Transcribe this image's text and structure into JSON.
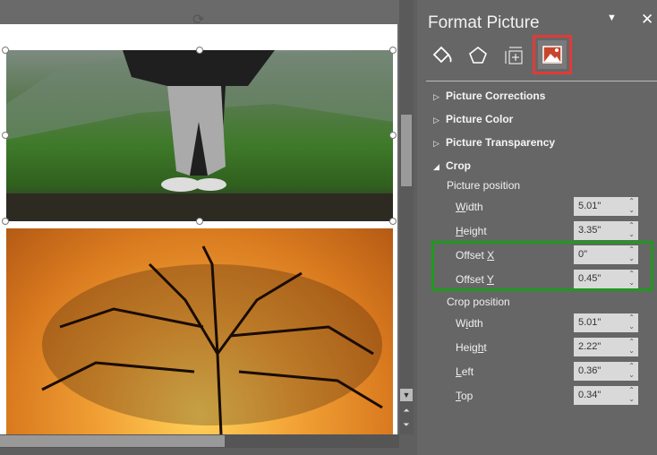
{
  "panel": {
    "title": "Format Picture",
    "tabs": [
      "fill-line",
      "effects",
      "size-properties",
      "picture"
    ],
    "sections": {
      "corrections": "Picture Corrections",
      "color": "Picture Color",
      "transparency": "Picture Transparency",
      "crop": "Crop"
    },
    "picture_position": {
      "heading": "Picture position",
      "width": {
        "label_u": "W",
        "label_rest": "idth",
        "value": "5.01\""
      },
      "height": {
        "label_u": "H",
        "label_rest": "eight",
        "value": "3.35\""
      },
      "offset_x": {
        "label": "Offset ",
        "label_u": "X",
        "value": "0\""
      },
      "offset_y": {
        "label": "Offset ",
        "label_u": "Y",
        "value": "0.45\""
      }
    },
    "crop_position": {
      "heading": "Crop position",
      "width": {
        "a": "W",
        "u": "i",
        "b": "dth",
        "value": "5.01\""
      },
      "height": {
        "a": "Heig",
        "u": "h",
        "b": "t",
        "value": "2.22\""
      },
      "left": {
        "u": "L",
        "b": "eft",
        "value": "0.36\""
      },
      "top": {
        "u": "T",
        "b": "op",
        "value": "0.34\""
      }
    }
  },
  "colors": {
    "highlight_tab": "#e03a3a",
    "highlight_box": "#1e9a1e"
  }
}
